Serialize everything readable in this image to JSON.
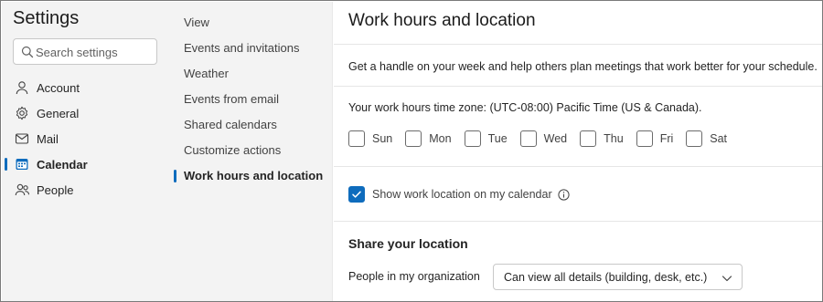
{
  "app": {
    "title": "Settings"
  },
  "search": {
    "placeholder": "Search settings"
  },
  "sidebar": {
    "items": [
      {
        "label": "Account",
        "icon": "person-icon"
      },
      {
        "label": "General",
        "icon": "gear-icon"
      },
      {
        "label": "Mail",
        "icon": "mail-icon"
      },
      {
        "label": "Calendar",
        "icon": "calendar-icon",
        "active": true
      },
      {
        "label": "People",
        "icon": "people-icon"
      }
    ]
  },
  "subnav": {
    "items": [
      {
        "label": "View"
      },
      {
        "label": "Events and invitations"
      },
      {
        "label": "Weather"
      },
      {
        "label": "Events from email"
      },
      {
        "label": "Shared calendars"
      },
      {
        "label": "Customize actions"
      },
      {
        "label": "Work hours and location",
        "active": true
      }
    ]
  },
  "main": {
    "title": "Work hours and location",
    "description": "Get a handle on your week and help others plan meetings that work better for your schedule.",
    "timezone_text": "Your work hours time zone: (UTC-08:00) Pacific Time (US & Canada).",
    "days": [
      {
        "label": "Sun",
        "checked": false
      },
      {
        "label": "Mon",
        "checked": false
      },
      {
        "label": "Tue",
        "checked": false
      },
      {
        "label": "Wed",
        "checked": false
      },
      {
        "label": "Thu",
        "checked": false
      },
      {
        "label": "Fri",
        "checked": false
      },
      {
        "label": "Sat",
        "checked": false
      }
    ],
    "show_location": {
      "label": "Show work location on my calendar",
      "checked": true
    },
    "share_title": "Share your location",
    "org_label": "People in my organization",
    "org_value": "Can view all details (building, desk, etc.)"
  },
  "colors": {
    "accent": "#0f6cbd",
    "nav_bg": "#f3f3f3"
  }
}
